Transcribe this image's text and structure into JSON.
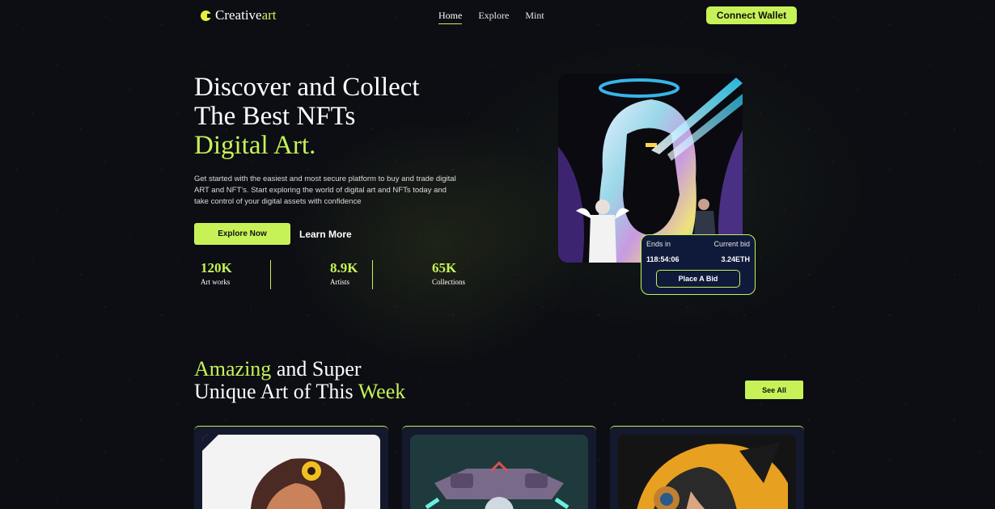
{
  "brand": {
    "name_main": "Creative",
    "name_accent": "art"
  },
  "nav": {
    "links": [
      {
        "label": "Home"
      },
      {
        "label": "Explore"
      },
      {
        "label": "Mint"
      }
    ],
    "connect_label": "Connect Wallet"
  },
  "hero": {
    "title_line1": "Discover and Collect",
    "title_line2": "The Best NFTs",
    "title_line3": "Digital Art.",
    "description": "Get started with the easiest and most secure platform to buy and trade digital ART and NFT's. Start exploring the world of digital art and NFTs today and take control of your digital assets with confidence",
    "explore_label": "Explore Now",
    "learn_label": "Learn More",
    "stats": [
      {
        "value": "120K",
        "label": "Art works"
      },
      {
        "value": "8.9K",
        "label": "Artists"
      },
      {
        "value": "65K",
        "label": "Collections"
      }
    ]
  },
  "bid": {
    "ends_label": "Ends in",
    "current_label": "Current bid",
    "time": "118:54:06",
    "price": "3.24ETH",
    "button_label": "Place A Bid"
  },
  "section": {
    "title_a": "Amazing",
    "title_b": " and Super",
    "title_c": "Unique Art of This ",
    "title_d": "Week",
    "see_all_label": "See All"
  },
  "icons": [
    "logo-icon"
  ],
  "colors": {
    "accent": "#c7f257",
    "bg": "#0c0e13",
    "card": "#14192e",
    "bid_bg": "#0f1a3a"
  }
}
